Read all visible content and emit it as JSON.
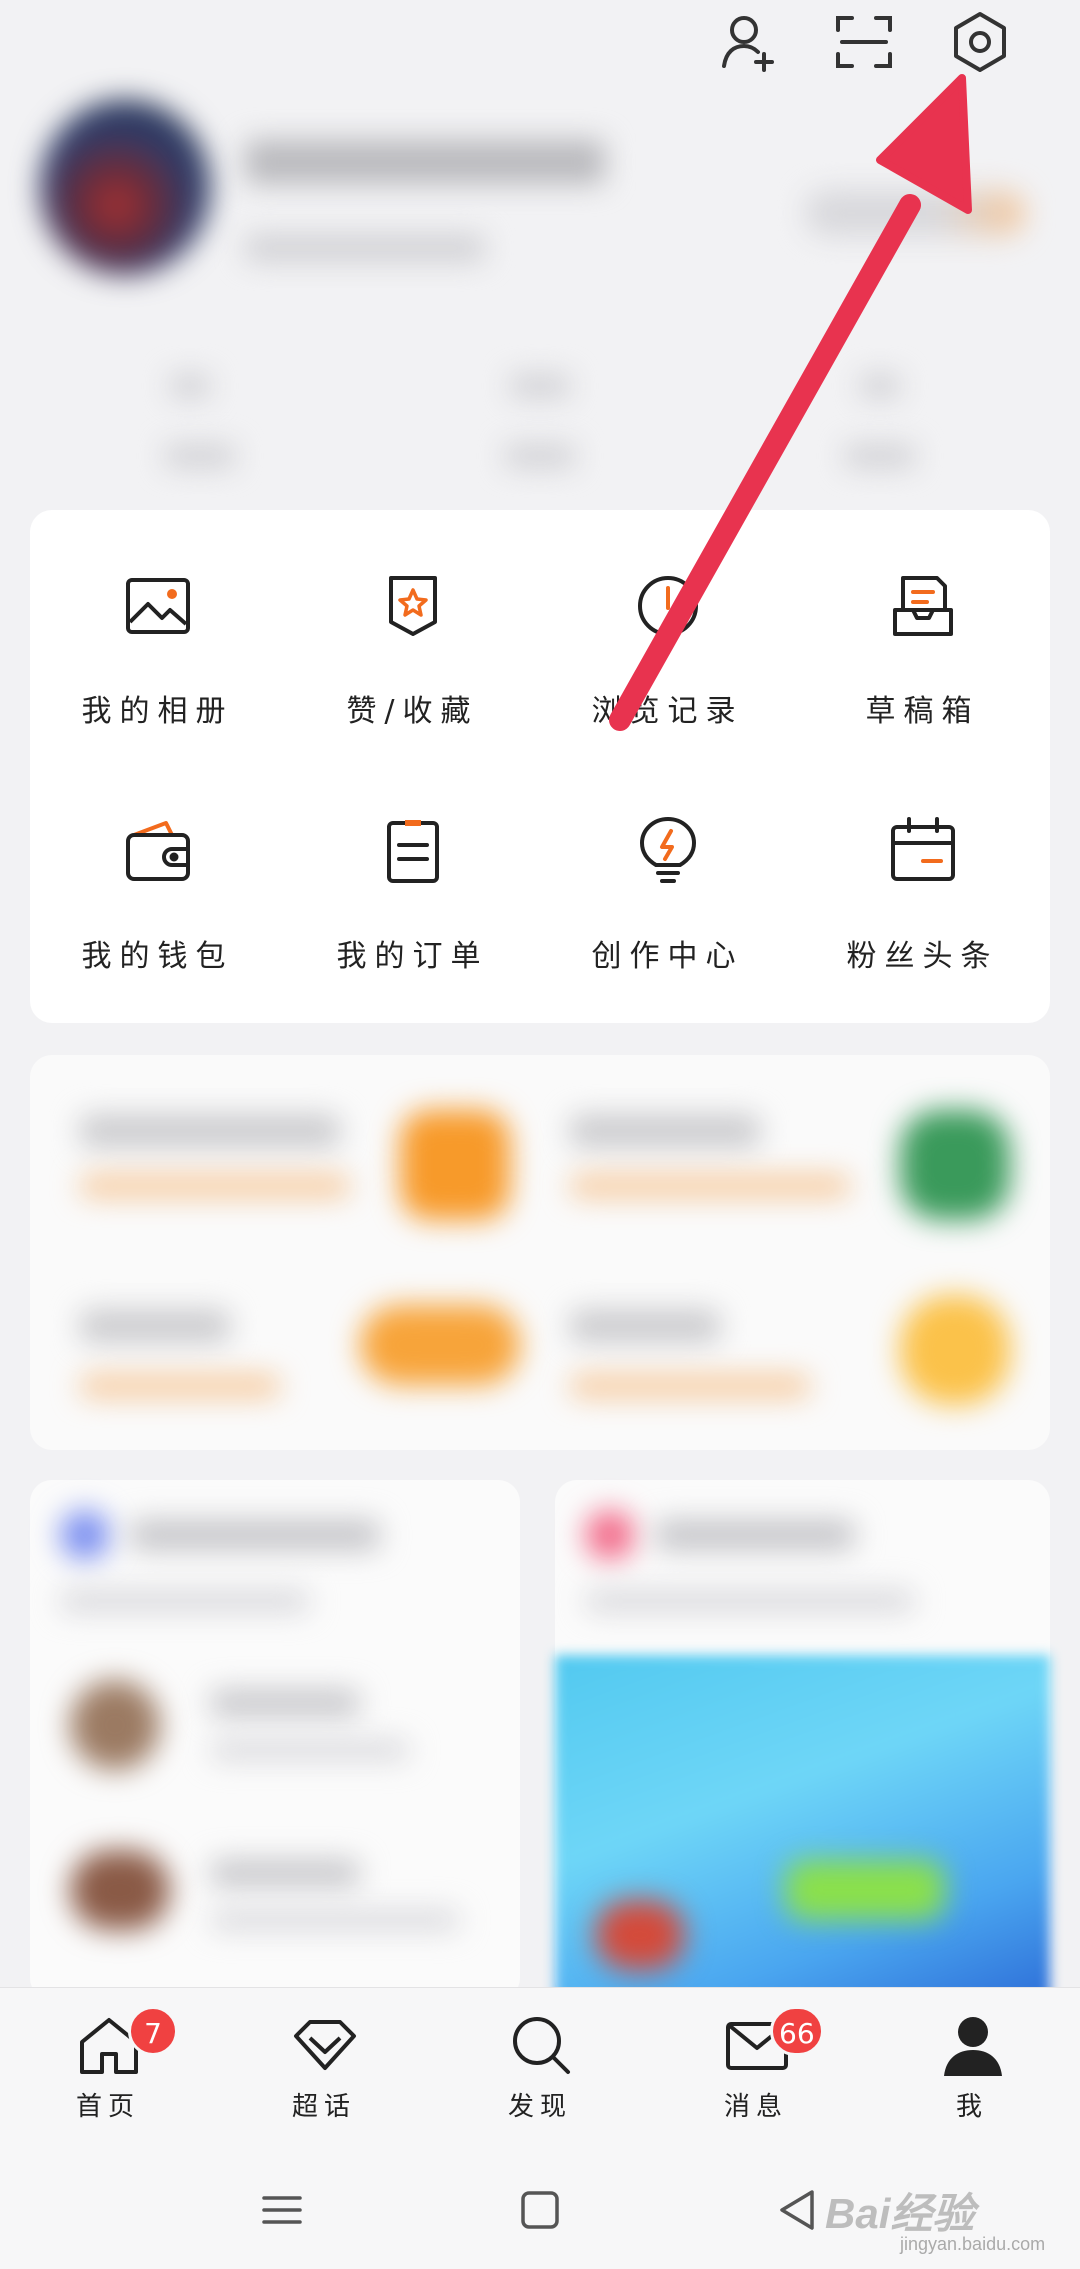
{
  "header": {
    "icons": [
      "add-friend-icon",
      "scan-icon",
      "settings-icon"
    ]
  },
  "grid": {
    "items": [
      {
        "label": "我的相册",
        "icon": "album-icon"
      },
      {
        "label": "赞/收藏",
        "icon": "favorite-icon"
      },
      {
        "label": "浏览记录",
        "icon": "history-icon"
      },
      {
        "label": "草稿箱",
        "icon": "drafts-icon"
      },
      {
        "label": "我的钱包",
        "icon": "wallet-icon"
      },
      {
        "label": "我的订单",
        "icon": "orders-icon"
      },
      {
        "label": "创作中心",
        "icon": "creator-icon"
      },
      {
        "label": "粉丝头条",
        "icon": "fans-headline-icon"
      }
    ]
  },
  "nav": {
    "items": [
      {
        "label": "首页",
        "icon": "home-icon",
        "badge": "7"
      },
      {
        "label": "超话",
        "icon": "super-topic-icon"
      },
      {
        "label": "发现",
        "icon": "search-icon"
      },
      {
        "label": "消息",
        "icon": "mail-icon",
        "badge": "66"
      },
      {
        "label": "我",
        "icon": "profile-icon"
      }
    ]
  },
  "watermark": {
    "text": "Bai经验",
    "sub": "jingyan.baidu.com"
  },
  "colors": {
    "accent": "#f26b1d",
    "badge": "#f04141",
    "arrow": "#e8334f"
  }
}
